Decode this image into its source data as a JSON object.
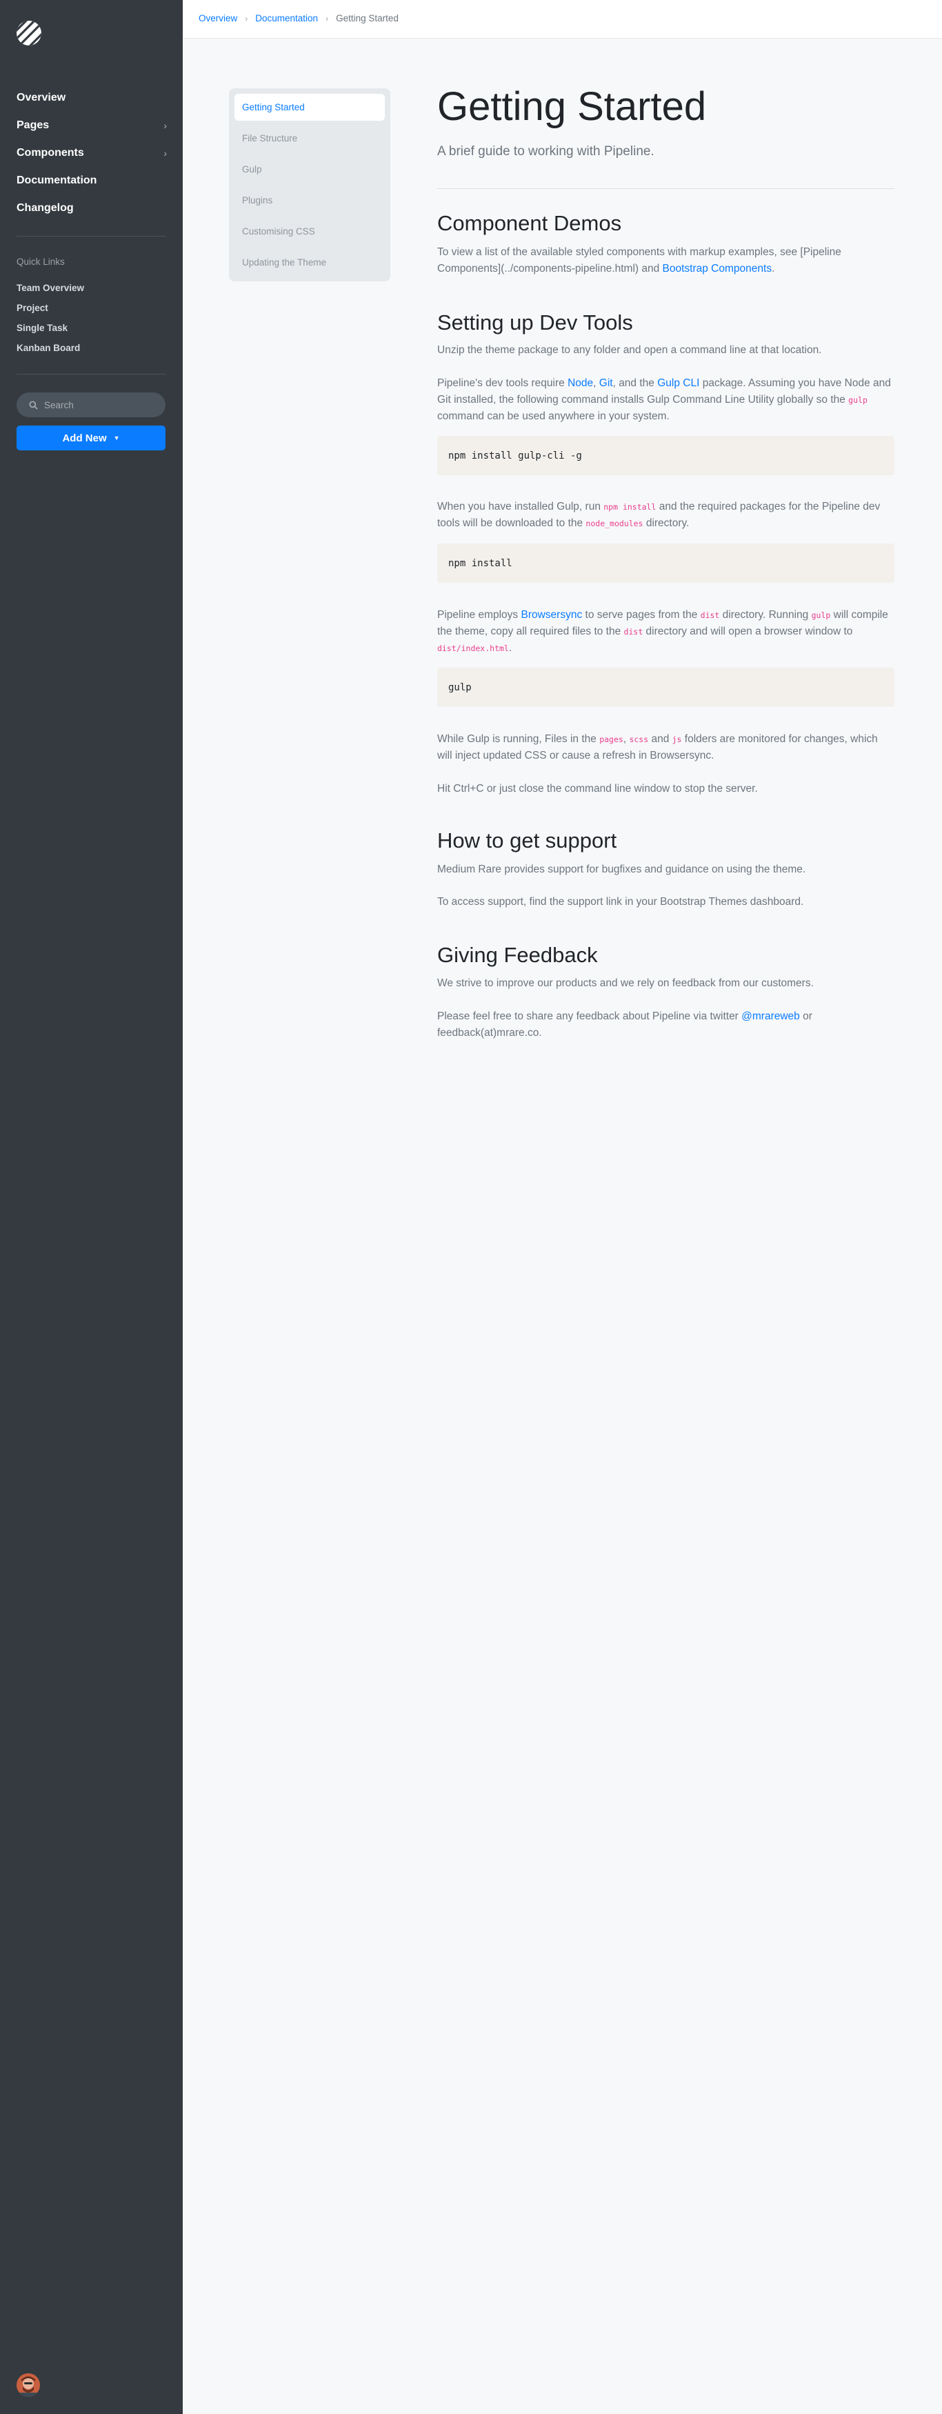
{
  "sidebar": {
    "nav": [
      {
        "label": "Overview",
        "has_children": false
      },
      {
        "label": "Pages",
        "has_children": true
      },
      {
        "label": "Components",
        "has_children": true
      },
      {
        "label": "Documentation",
        "has_children": false
      },
      {
        "label": "Changelog",
        "has_children": false
      }
    ],
    "quick_links_title": "Quick Links",
    "quick_links": [
      "Team Overview",
      "Project",
      "Single Task",
      "Kanban Board"
    ],
    "search_placeholder": "Search",
    "add_new_label": "Add New"
  },
  "breadcrumb": {
    "items": [
      "Overview",
      "Documentation"
    ],
    "current": "Getting Started"
  },
  "docnav": {
    "items": [
      "Getting Started",
      "File Structure",
      "Gulp",
      "Plugins",
      "Customising CSS",
      "Updating the Theme"
    ],
    "active_index": 0
  },
  "page": {
    "title": "Getting Started",
    "lead": "A brief guide to working with Pipeline.",
    "component_demos": {
      "heading": "Component Demos",
      "text_1": "To view a list of the available styled components with markup examples, see [Pipeline Components](../components-pipeline.html) and ",
      "link": "Bootstrap Components",
      "text_2": "."
    },
    "dev_tools": {
      "heading": "Setting up Dev Tools",
      "p1": "Unzip the theme package to any folder and open a command line at that location.",
      "p2": {
        "t1": "Pipeline's dev tools require ",
        "node": "Node",
        "t2": ", ",
        "git": "Git",
        "t3": ", and the ",
        "gulpcli": "Gulp CLI",
        "t4": " package. Assuming you have Node and Git installed, the following command installs Gulp Command Line Utility globally so the ",
        "code": "gulp",
        "t5": " command can be used anywhere in your system."
      },
      "code1": "npm install gulp-cli -g",
      "p3": {
        "t1": "When you have installed Gulp, run ",
        "code1": "npm install",
        "t2": " and the required packages for the Pipeline dev tools will be downloaded to the ",
        "code2": "node_modules",
        "t3": " directory."
      },
      "code2": "npm install",
      "p4": {
        "t1": "Pipeline employs ",
        "link": "Browsersync",
        "t2": " to serve pages from the ",
        "code1": "dist",
        "t3": " directory. Running ",
        "code2": "gulp",
        "t4": " will compile the theme, copy all required files to the ",
        "code3": "dist",
        "t5": " directory and will open a browser window to ",
        "code4": "dist/index.html",
        "t6": "."
      },
      "code3": "gulp",
      "p5": {
        "t1": "While Gulp is running, Files in the ",
        "code1": "pages",
        "t2": ", ",
        "code2": "scss",
        "t3": " and ",
        "code3": "js",
        "t4": " folders are monitored for changes, which will inject updated CSS or cause a refresh in Browsersync."
      },
      "p6": "Hit Ctrl+C or just close the command line window to stop the server."
    },
    "support": {
      "heading": "How to get support",
      "p1": "Medium Rare provides support for bugfixes and guidance on using the theme.",
      "p2": "To access support, find the support link in your Bootstrap Themes dashboard."
    },
    "feedback": {
      "heading": "Giving Feedback",
      "p1": "We strive to improve our products and we rely on feedback from our customers.",
      "p2_t1": "Please feel free to share any feedback about Pipeline via twitter ",
      "p2_link": "@mrareweb",
      "p2_t2": " or feedback(at)mrare.co."
    }
  },
  "colors": {
    "sidebar_bg": "#343a40",
    "accent": "#0a7cff",
    "code_pink": "#e83e8c"
  }
}
